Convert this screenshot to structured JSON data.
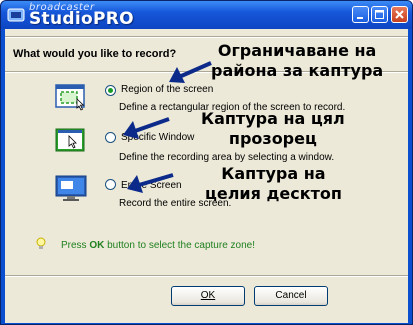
{
  "window": {
    "brand_small": "broadcaster",
    "brand_big": "StudioPRO"
  },
  "heading": "What would you like to record?",
  "options": [
    {
      "label": "Region of the screen",
      "description": "Define a rectangular region of the screen to record.",
      "selected": true,
      "annotation_lines": [
        "Ограничаване на",
        "района за каптура"
      ]
    },
    {
      "label": "Specific Window",
      "description": "Define the recording area by selecting a window.",
      "selected": false,
      "annotation_lines": [
        "Каптура на цял",
        "прозорец"
      ]
    },
    {
      "label": "Entire Screen",
      "description": "Record the entire screen.",
      "selected": false,
      "annotation_lines": [
        "Каптура на",
        "целия десктоп"
      ]
    }
  ],
  "tip": {
    "prefix": "Press ",
    "key": "OK",
    "suffix": " button to select the capture zone!"
  },
  "buttons": {
    "ok": "OK",
    "cancel": "Cancel"
  },
  "colors": {
    "title_bar": "#1657d9",
    "dialog_bg": "#ece9d8",
    "tip_text": "#208020",
    "radio_selected": "#1a9c2a",
    "arrow": "#0b2a8a"
  }
}
